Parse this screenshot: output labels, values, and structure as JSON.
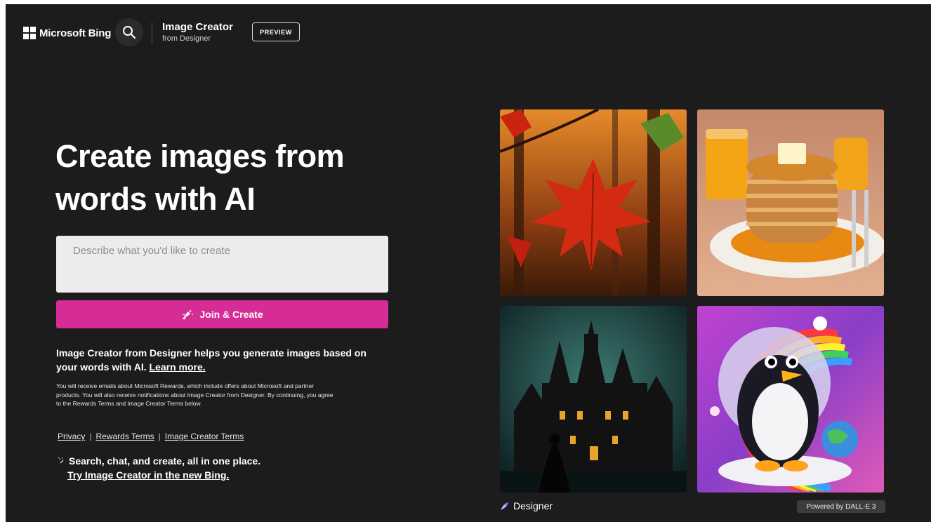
{
  "header": {
    "brand": "Microsoft Bing",
    "product_title": "Image Creator",
    "product_subtitle": "from Designer",
    "preview_label": "PREVIEW"
  },
  "hero": {
    "headline_line1": "Create images from",
    "headline_line2": "words with AI"
  },
  "prompt": {
    "placeholder": "Describe what you'd like to create",
    "value": ""
  },
  "create_button": {
    "label": "Join & Create"
  },
  "description": {
    "text": "Image Creator from Designer helps you generate images based on your words with AI.",
    "learn_more": "Learn more."
  },
  "fine_print": "You will receive emails about Microsoft Rewards, which include offers about Microsoft and partner products. You will also receive notifications about Image Creator from Designer. By continuing, you agree to the Rewards Terms and Image Creator Terms below.",
  "links": {
    "privacy": "Privacy",
    "separator": "|",
    "rewards_terms": "Rewards Terms",
    "image_creator_terms": "Image Creator Terms"
  },
  "promo": {
    "line1": "Search, chat, and create, all in one place.",
    "line2": "Try Image Creator in the new Bing."
  },
  "gallery": {
    "designer_label": "Designer",
    "powered_by": "Powered by DALL-E 3"
  },
  "colors": {
    "background": "#1c1c1c",
    "accent": "#d62c95",
    "input_bg": "#ececec"
  }
}
